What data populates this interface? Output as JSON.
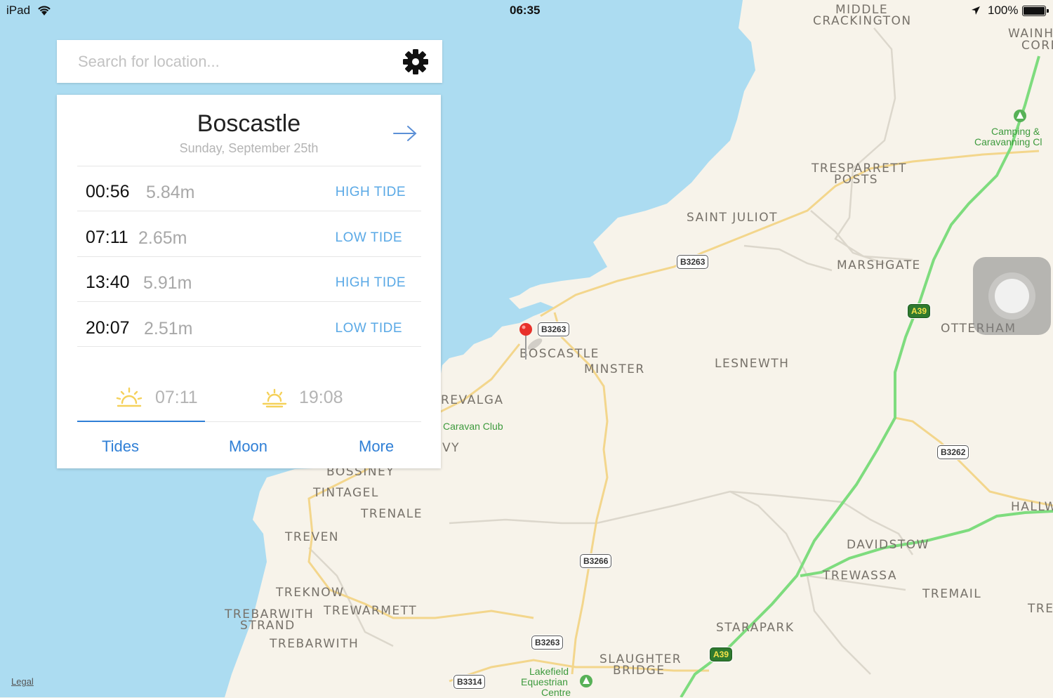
{
  "status_bar": {
    "device": "iPad",
    "time": "06:35",
    "battery": "100%",
    "icons": [
      "wifi-icon",
      "location-arrow-icon",
      "battery-icon"
    ]
  },
  "search": {
    "placeholder": "Search for location...",
    "settings_icon": "gear-icon"
  },
  "tide_panel": {
    "place": "Boscastle",
    "date": "Sunday, September 25th",
    "tides": [
      {
        "time": "00:56",
        "height": "5.84m",
        "kind": "HIGH TIDE"
      },
      {
        "time": "07:11",
        "height": "2.65m",
        "kind": "LOW TIDE"
      },
      {
        "time": "13:40",
        "height": "5.91m",
        "kind": "HIGH TIDE"
      },
      {
        "time": "20:07",
        "height": "2.51m",
        "kind": "LOW TIDE"
      }
    ],
    "sunrise": "07:11",
    "sunset": "19:08",
    "tabs": [
      "Tides",
      "Moon",
      "More"
    ],
    "active_tab": "Tides"
  },
  "map": {
    "place_labels": [
      "Middle",
      "Crackington",
      "Wainh",
      "Corn",
      "Tresparrett",
      "Posts",
      "Saint Juliot",
      "Marshgate",
      "Otterham",
      "Boscastle",
      "Minster",
      "Lesnewth",
      "revalga",
      "vy",
      "Bossiney",
      "Tintagel",
      "Trenale",
      "Treven",
      "Treknow",
      "Trebarwith",
      "Strand",
      "Trewarmett",
      "Trebarwith",
      "Davidstow",
      "Trewassa",
      "Tremail",
      "Tre",
      "Hallw",
      "Starapark",
      "Slaughter",
      "Bridge"
    ],
    "poi_labels": [
      "Camping &",
      "Caravanning Cl",
      "Caravan Club",
      "Lakefield",
      "Equestrian",
      "Centre"
    ],
    "road_shields": [
      "B3263",
      "B3263",
      "A39",
      "B3262",
      "B3266",
      "B3263",
      "A39",
      "B3314"
    ],
    "legal": "Legal",
    "colors": {
      "water": "#acdcf1",
      "land": "#f7f3ea",
      "highway": "#7edc7e",
      "road": "#f3d68c",
      "pin": "#e8302a"
    }
  }
}
